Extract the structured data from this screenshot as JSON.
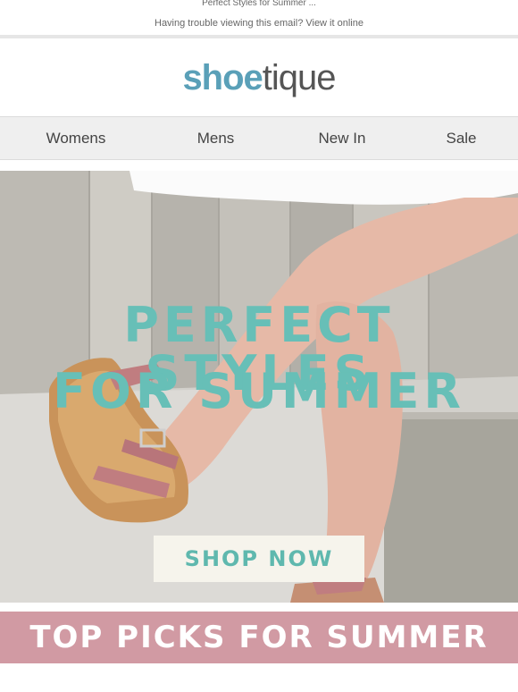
{
  "preheader": "Perfect Styles for Summer ...",
  "trouble": "Having trouble viewing this email? View it online",
  "logo": {
    "part1": "shoe",
    "part2": "tique"
  },
  "nav": [
    {
      "label": "Womens"
    },
    {
      "label": "Mens"
    },
    {
      "label": "New In"
    },
    {
      "label": "Sale"
    }
  ],
  "hero": {
    "line1": "PERFECT STYLES",
    "line2": "FOR SUMMER",
    "cta": "SHOP NOW"
  },
  "section_banner": "TOP PICKS FOR SUMMER",
  "colors": {
    "brand_teal": "#5aa0b8",
    "hero_text": "#67bfb7",
    "banner_pink": "#d19aa3"
  }
}
